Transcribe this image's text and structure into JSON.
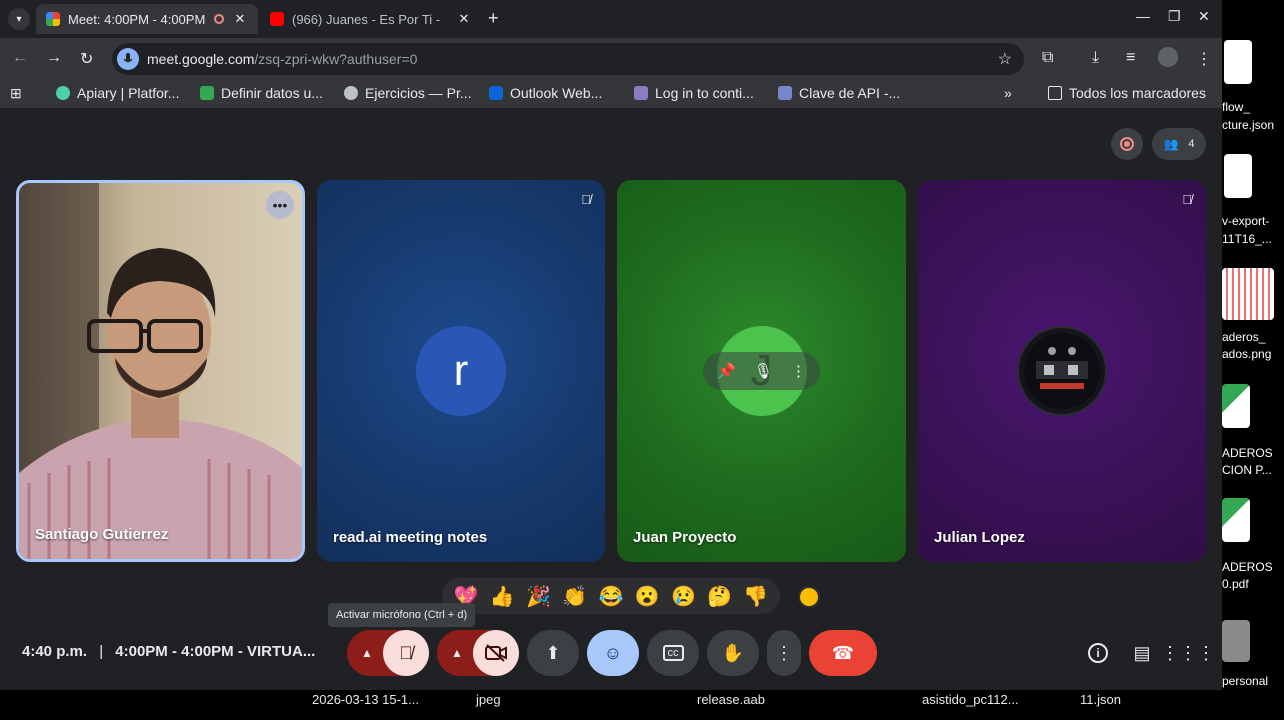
{
  "browser": {
    "tabs": [
      {
        "title": "Meet: 4:00PM - 4:00PM",
        "active": true
      },
      {
        "title": "(966) Juanes - Es Por Ti - ",
        "active": false
      }
    ],
    "url_host": "meet.google.com",
    "url_path": "/zsq-zpri-wkw?authuser=0",
    "bookmarks": [
      "Apiary | Platfor...",
      "Definir datos u...",
      "Ejercicios — Pr...",
      "Outlook Web...",
      "Log in to conti...",
      "Clave de API -...",
      "Todos los marcadores"
    ]
  },
  "meet": {
    "participant_count": "4",
    "tiles": [
      {
        "name": "Santiago Gutierrez",
        "avatar": ""
      },
      {
        "name": "read.ai meeting notes",
        "avatar": "r"
      },
      {
        "name": "Juan Proyecto",
        "avatar": "J"
      },
      {
        "name": "Julian Lopez",
        "avatar": ""
      }
    ],
    "reactions": [
      "💖",
      "👍",
      "🎉",
      "👏",
      "😂",
      "😮",
      "😢",
      "🤔",
      "👎"
    ],
    "tooltip": "Activar micrófono (Ctrl + d)",
    "time": "4:40 p.m.",
    "separator": "|",
    "meeting_title": "4:00PM - 4:00PM - VIRTUA..."
  },
  "desktop": {
    "files": [
      "flow_",
      "cture.json",
      "v-export-",
      "11T16_...",
      "aderos_",
      "ados.png",
      "ADEROS",
      "CION P...",
      "ADEROS",
      "0.pdf",
      "personal"
    ]
  },
  "taskbar": {
    "files": [
      "2026-03-13 15-1...",
      "jpeg",
      "release.aab",
      "asistido_pc112...",
      "11.json"
    ]
  },
  "colors": {
    "tile_blue": "#1a3a6b",
    "tile_green": "#1e6b1e",
    "tile_purple": "#3b1258",
    "end_call": "#ea4335"
  }
}
